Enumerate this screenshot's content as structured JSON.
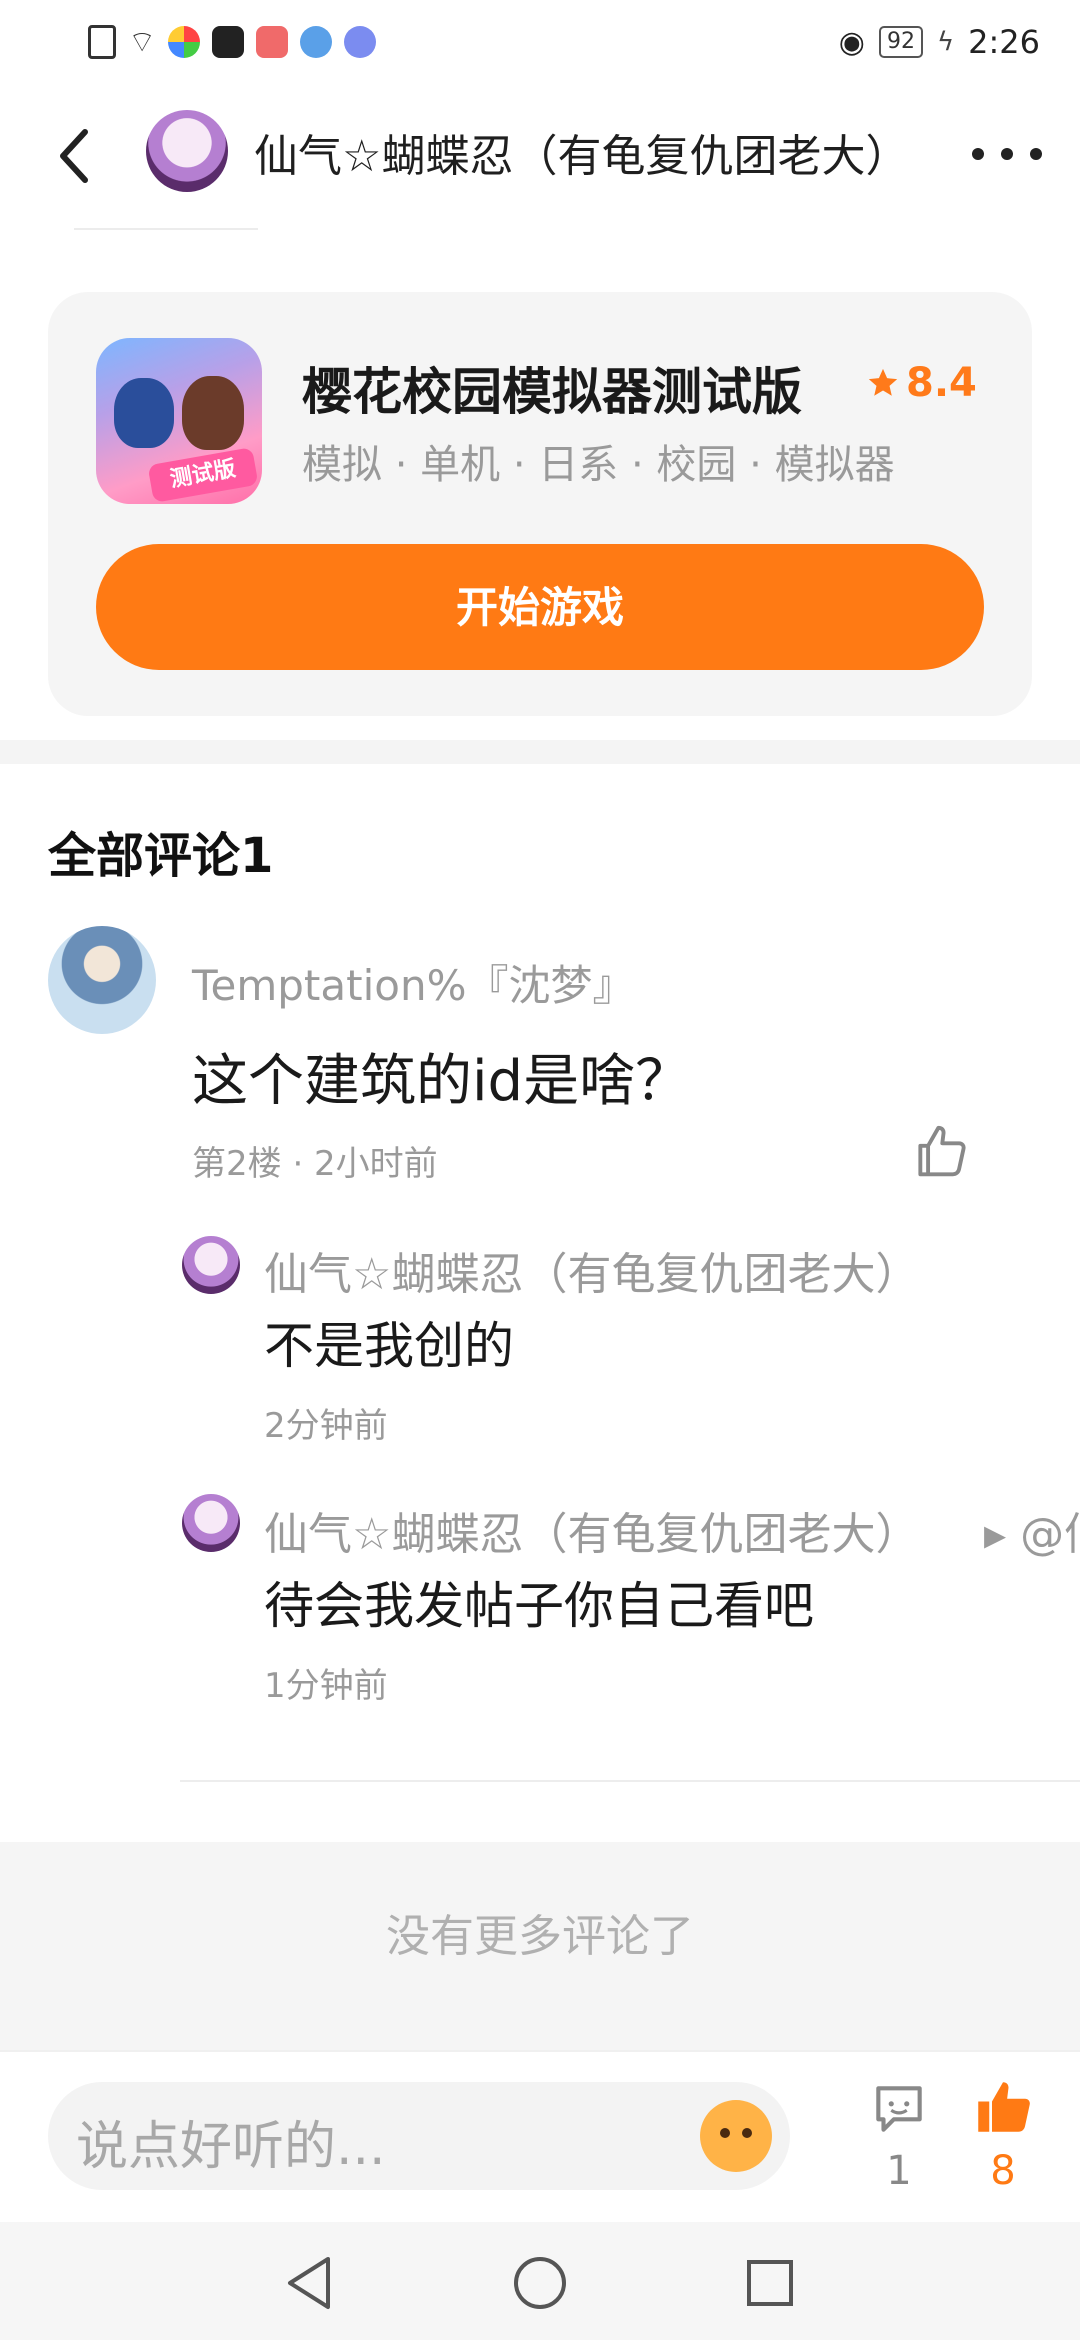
{
  "status_bar": {
    "battery": "92",
    "time": "2:26"
  },
  "header": {
    "title": "仙气☆蝴蝶忍（有龟复仇团老大）"
  },
  "game_card": {
    "name": "樱花校园模拟器测试版",
    "rating": "8.4",
    "tags": "模拟 · 单机 · 日系 · 校园 · 模拟器",
    "icon_badge": "测试版",
    "play_button": "开始游戏"
  },
  "comments": {
    "section_title": "全部评论1",
    "items": [
      {
        "user": "Temptation%『沈梦』",
        "text": "这个建筑的id是啥？",
        "meta": "第2楼 · 2小时前",
        "replies": [
          {
            "user": "仙气☆蝴蝶忍（有龟复仇团老大）",
            "text": "不是我创的",
            "time": "2分钟前"
          },
          {
            "user": "仙气☆蝴蝶忍（有龟复仇团老大）",
            "reply_to": "▸ @仙",
            "text": "待会我发帖子你自己看吧",
            "time": "1分钟前"
          }
        ]
      }
    ],
    "no_more": "没有更多评论了"
  },
  "bottom_bar": {
    "input_placeholder": "说点好听的...",
    "comment_count": "1",
    "like_count": "8"
  },
  "colors": {
    "accent": "#ff7a14",
    "muted_text": "#9a9a9a",
    "card_bg": "#f5f5f5"
  }
}
